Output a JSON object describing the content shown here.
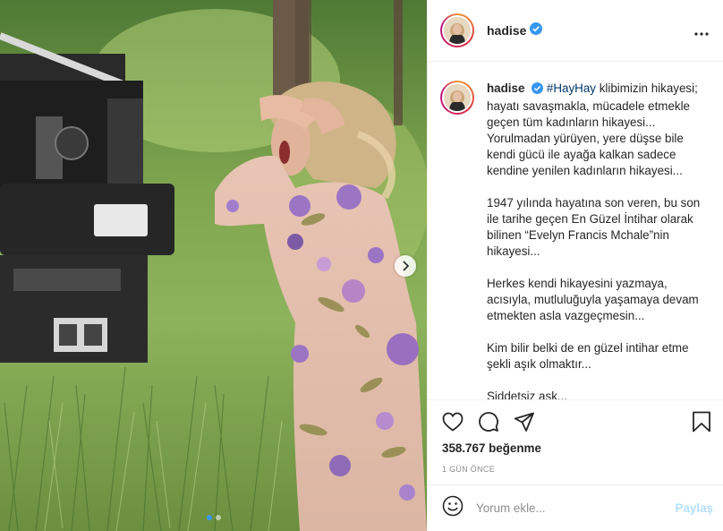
{
  "post": {
    "username": "hadise",
    "verified": true,
    "more_icon": "more-horizontal-icon",
    "caption": {
      "author": "hadise",
      "hashtag": "#HayHay",
      "line1_rest": " klibimizin hikayesi; hayatı savaşmakla, mücadele etmekle geçen tüm kadınların hikayesi... Yorulmadan yürüyen, yere düşse bile kendi gücü ile ayağa kalkan sadece kendine yenilen kadınların hikayesi...",
      "p2": "1947 yılında hayatına son veren, bu son ile tarihe geçen En Güzel İntihar olarak bilinen “Evelyn Francis Mchale”nin hikayesi...",
      "p3": "Herkes kendi hikayesini yazmaya, acısıyla, mutluluğuyla yaşamaya devam etmekten asla vazgeçmesin...",
      "p4": "Kim bilir belki de en güzel intihar etme şekli aşık olmaktır...",
      "p5_partial": "Şiddetsiz aşk..."
    },
    "likes": "358.767 beğenme",
    "time": "1 GÜN ÖNCE",
    "comment": {
      "placeholder": "Yorum ekle...",
      "share_label": "Paylaş"
    },
    "carousel": {
      "slide_count": 2,
      "active_index": 0
    }
  },
  "icons": {
    "like": "heart-icon",
    "comment": "comment-icon",
    "share": "send-icon",
    "save": "bookmark-icon",
    "emoji": "emoji-icon",
    "next": "chevron-right-icon"
  },
  "colors": {
    "verified": "#3897f0",
    "hashtag": "#00376b",
    "share_disabled": "#b2dffc",
    "muted": "#8e8e8e",
    "active_dot": "#3897f0"
  }
}
